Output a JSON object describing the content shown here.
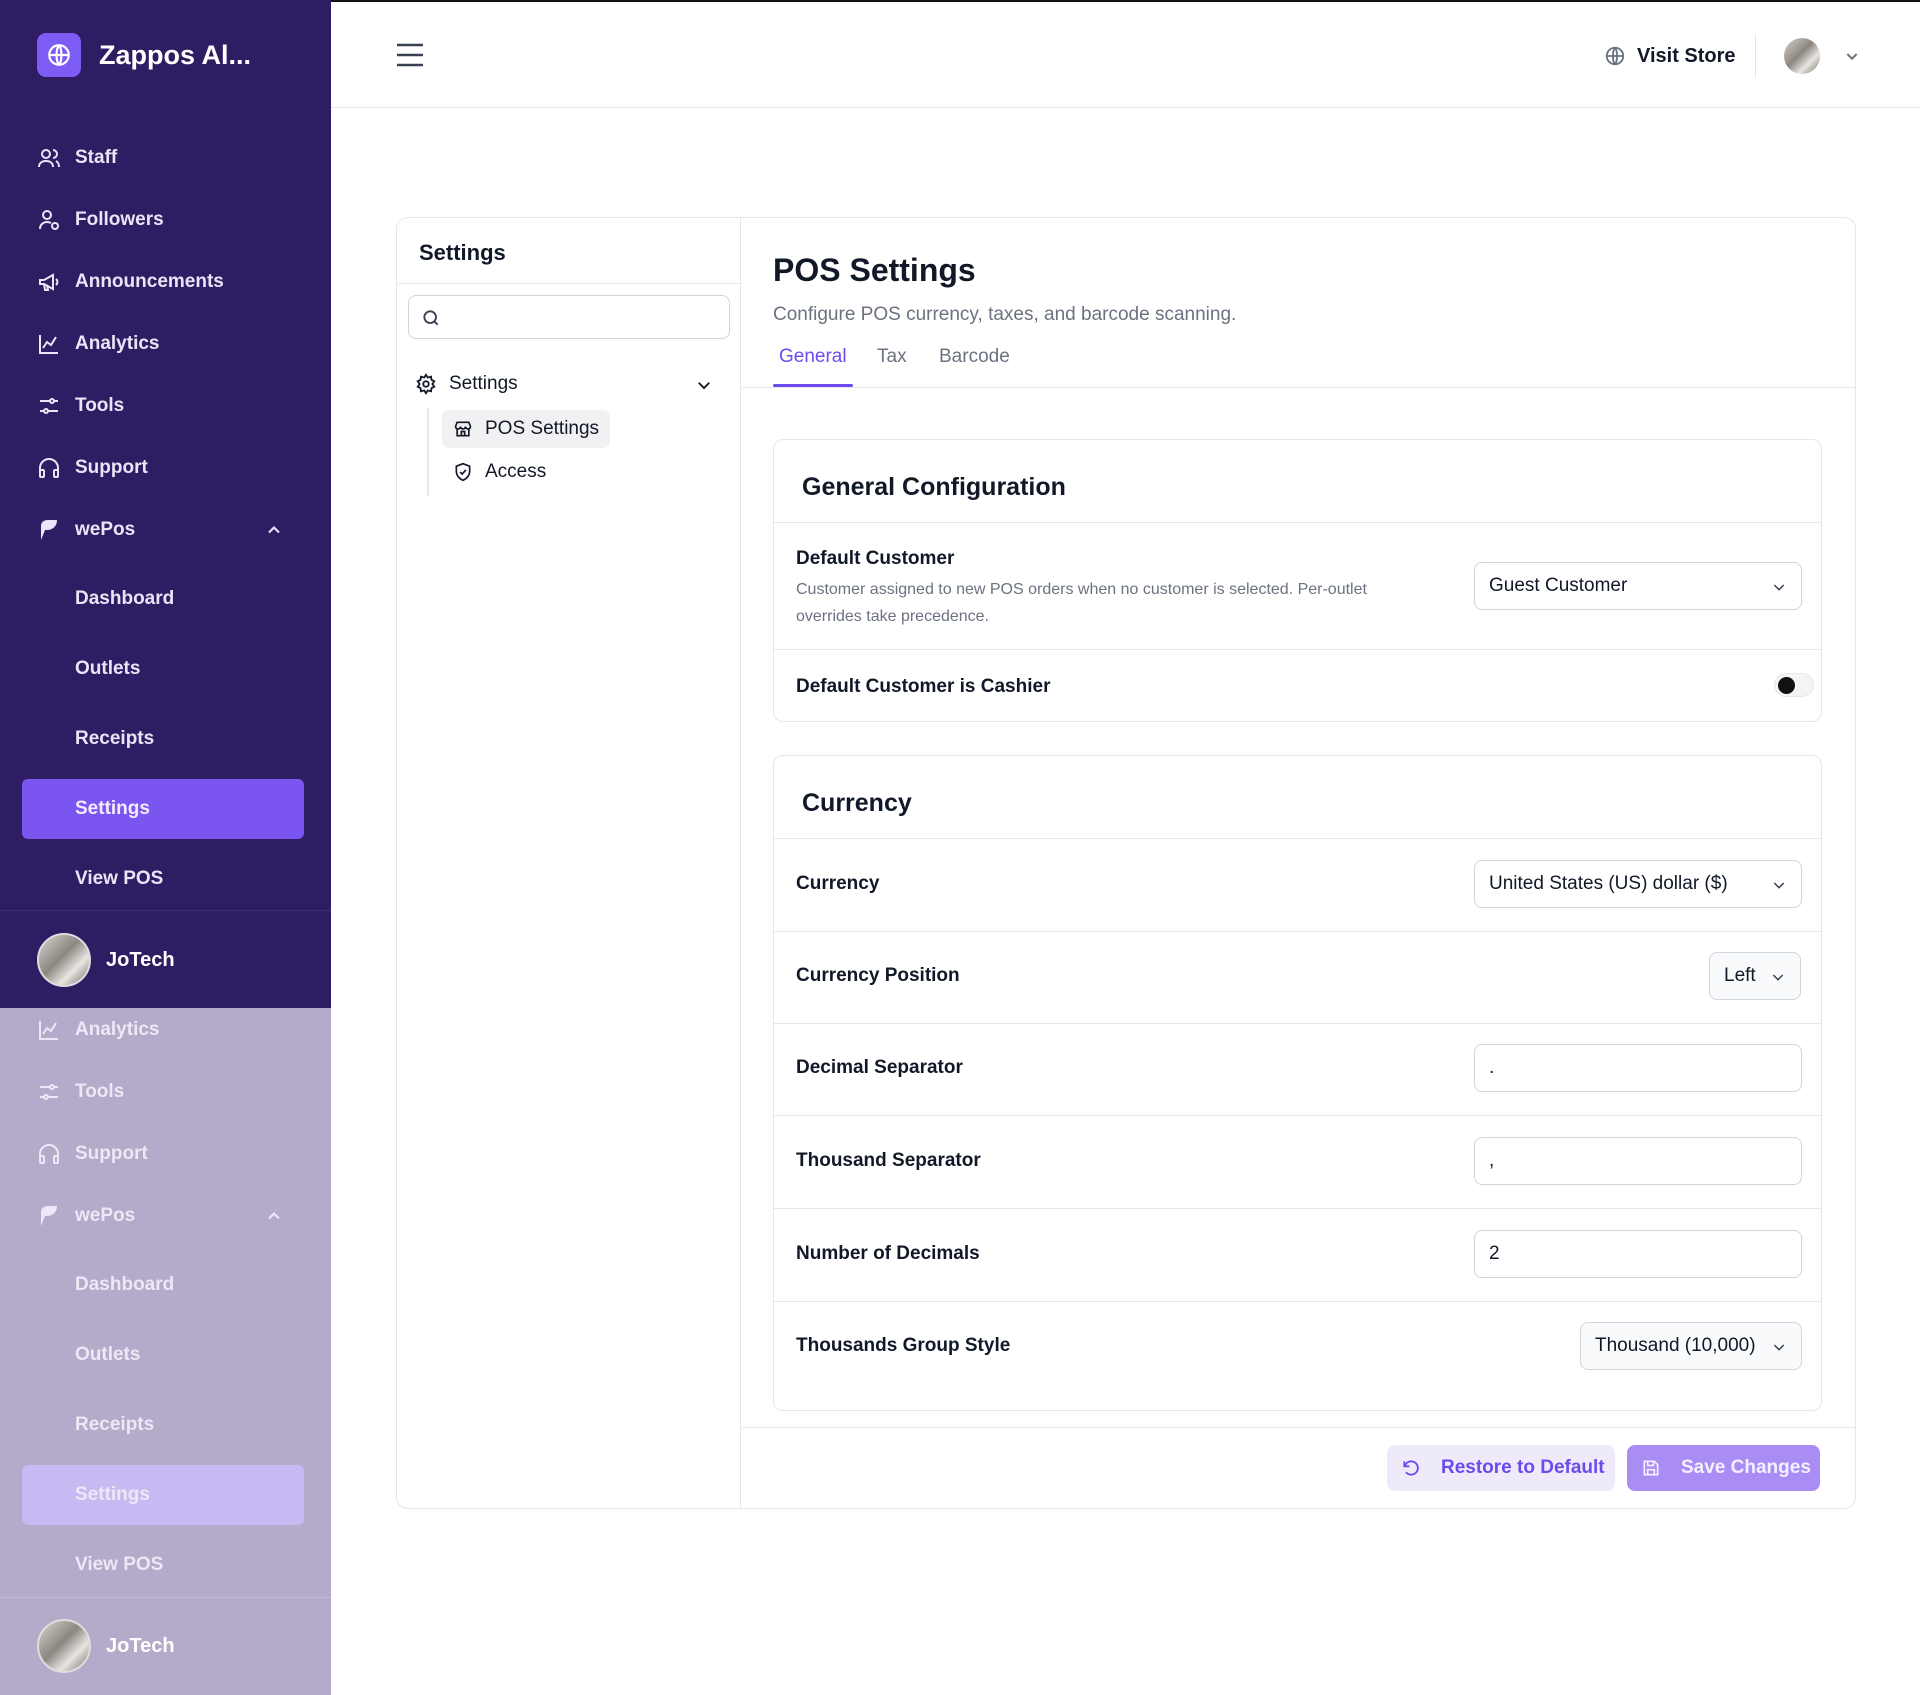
{
  "app": {
    "brand_name": "Zappos Al..."
  },
  "sidebar": {
    "top_items": [
      {
        "label": "Staff",
        "icon": "users-icon"
      },
      {
        "label": "Followers",
        "icon": "followers-icon"
      },
      {
        "label": "Announcements",
        "icon": "megaphone-icon"
      },
      {
        "label": "Analytics",
        "icon": "chart-icon"
      },
      {
        "label": "Tools",
        "icon": "sliders-icon"
      },
      {
        "label": "Support",
        "icon": "headphones-icon"
      }
    ],
    "group": {
      "label": "wePos",
      "icon": "wepos-icon",
      "expanded": true
    },
    "sub_items": [
      "Dashboard",
      "Outlets",
      "Receipts",
      "Settings",
      "View POS"
    ],
    "active_item": "Settings",
    "user": {
      "name": "JoTech"
    },
    "overlay_items": [
      {
        "label": "Analytics",
        "icon": "chart-icon"
      },
      {
        "label": "Tools",
        "icon": "sliders-icon"
      },
      {
        "label": "Support",
        "icon": "headphones-icon"
      }
    ]
  },
  "topbar": {
    "visit_store_label": "Visit Store"
  },
  "settings_nav": {
    "title": "Settings",
    "search_placeholder": "",
    "root_label": "Settings",
    "items": [
      {
        "label": "POS Settings",
        "icon": "store-icon",
        "active": true
      },
      {
        "label": "Access",
        "icon": "shield-check-icon",
        "active": false
      }
    ]
  },
  "page": {
    "title": "POS Settings",
    "subtitle": "Configure POS currency, taxes, and barcode scanning.",
    "tabs": [
      "General",
      "Tax",
      "Barcode"
    ],
    "active_tab": "General"
  },
  "general": {
    "title": "General Configuration",
    "default_customer": {
      "label": "Default Customer",
      "description": "Customer assigned to new POS orders when no customer is selected. Per-outlet overrides take precedence.",
      "value": "Guest Customer"
    },
    "cashier_toggle": {
      "label": "Default Customer is Cashier",
      "on": false
    }
  },
  "currency": {
    "title": "Currency",
    "currency": {
      "label": "Currency",
      "value": "United States (US) dollar ($)"
    },
    "position": {
      "label": "Currency Position",
      "value": "Left"
    },
    "decimal_separator": {
      "label": "Decimal Separator",
      "value": "."
    },
    "thousand_separator": {
      "label": "Thousand Separator",
      "value": ","
    },
    "decimals": {
      "label": "Number of Decimals",
      "value": "2"
    },
    "group_style": {
      "label": "Thousands Group Style",
      "value": "Thousand (10,000)"
    }
  },
  "actions": {
    "restore_label": "Restore to Default",
    "save_label": "Save Changes"
  },
  "colors": {
    "sidebar": "#2e1d63",
    "accent": "#6d4aed",
    "active_nav": "#7a55f0"
  }
}
